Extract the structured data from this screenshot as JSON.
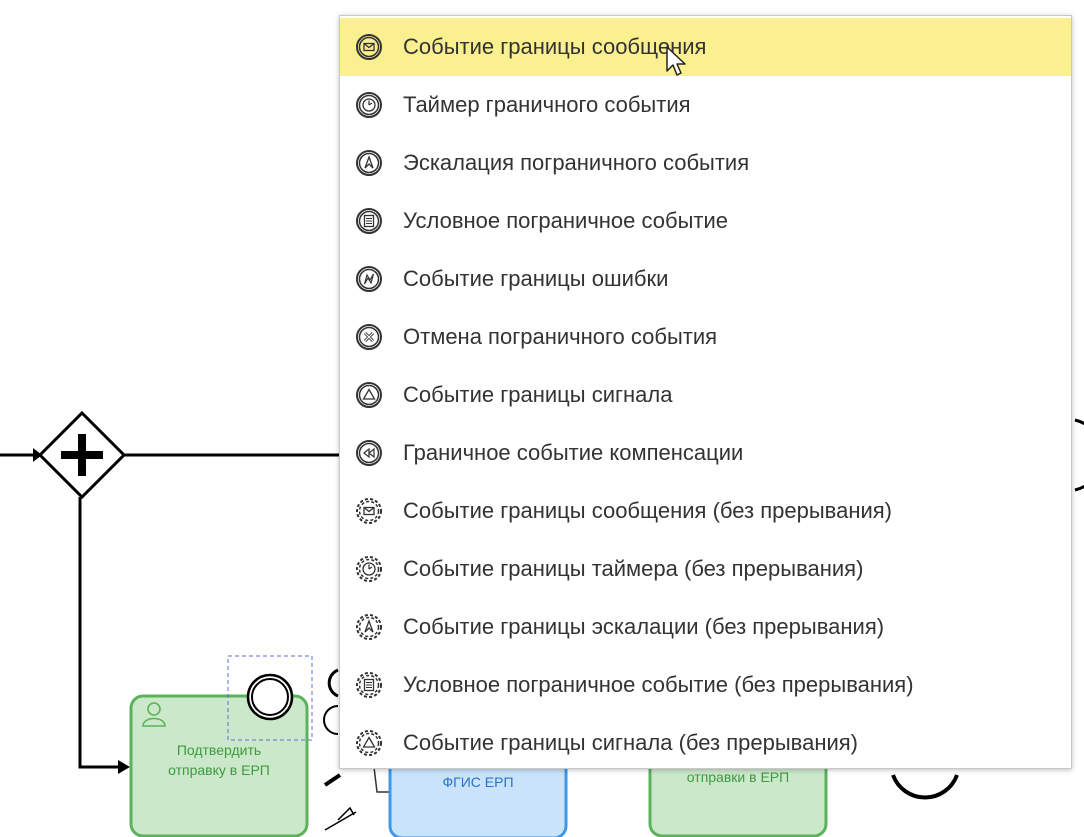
{
  "diagram": {
    "tasks": [
      {
        "id": "confirm",
        "label_line1": "Подтвердить",
        "label_line2": "отправку в ЕРП"
      },
      {
        "id": "fgis",
        "label": "ФГИС ЕРП"
      },
      {
        "id": "sending",
        "label": "отправки в ЕРП"
      }
    ],
    "colors": {
      "task_green_fill": "#cbe8cb",
      "task_green_stroke": "#5ab35a",
      "task_green_text": "#3d9a3d",
      "task_blue_fill": "#c9e3fb",
      "task_blue_stroke": "#3f97e6",
      "highlight": "#fbf08f"
    }
  },
  "menu": {
    "items": [
      {
        "label": "Событие границы сообщения",
        "icon": "message-boundary-event-icon",
        "active": true
      },
      {
        "label": "Таймер граничного события",
        "icon": "timer-boundary-event-icon"
      },
      {
        "label": "Эскалация пограничного события",
        "icon": "escalation-boundary-event-icon"
      },
      {
        "label": "Условное пограничное событие",
        "icon": "conditional-boundary-event-icon"
      },
      {
        "label": "Событие границы ошибки",
        "icon": "error-boundary-event-icon"
      },
      {
        "label": "Отмена пограничного события",
        "icon": "cancel-boundary-event-icon"
      },
      {
        "label": "Событие границы сигнала",
        "icon": "signal-boundary-event-icon"
      },
      {
        "label": "Граничное событие компенсации",
        "icon": "compensation-boundary-event-icon"
      },
      {
        "label": "Событие границы сообщения (без прерывания)",
        "icon": "message-non-interrupting-event-icon"
      },
      {
        "label": "Событие границы таймера (без прерывания)",
        "icon": "timer-non-interrupting-event-icon"
      },
      {
        "label": "Событие границы эскалации (без прерывания)",
        "icon": "escalation-non-interrupting-event-icon"
      },
      {
        "label": "Условное пограничное событие (без прерывания)",
        "icon": "conditional-non-interrupting-event-icon"
      },
      {
        "label": "Событие границы сигнала (без прерывания)",
        "icon": "signal-non-interrupting-event-icon"
      }
    ]
  }
}
